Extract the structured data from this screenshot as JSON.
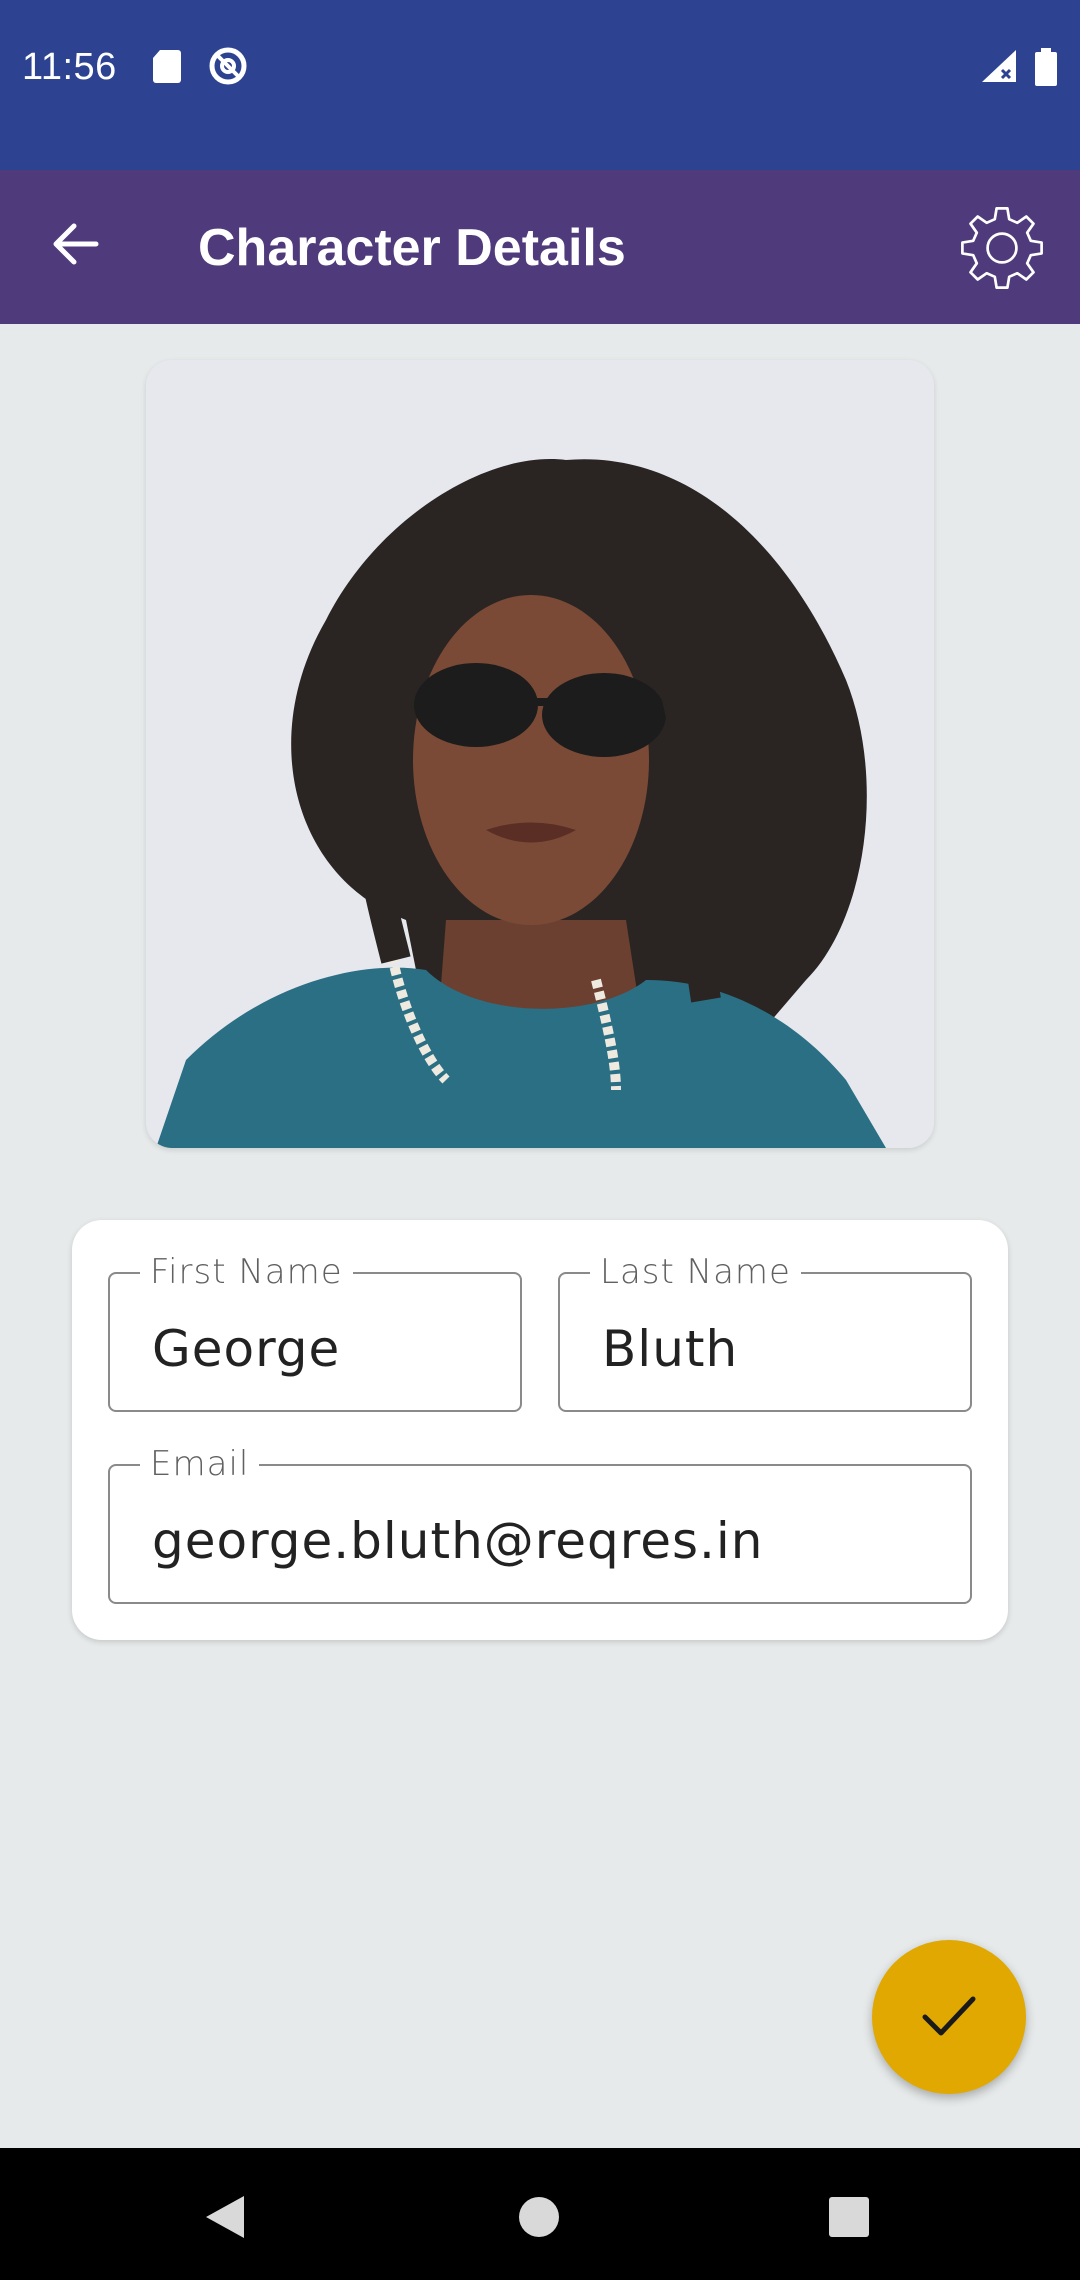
{
  "status_bar": {
    "time": "11:56",
    "icons": [
      "sd-card-icon",
      "at-sign-icon",
      "signal-icon",
      "battery-icon"
    ],
    "background": "#2d4391"
  },
  "app_bar": {
    "title": "Character Details",
    "back_icon": "arrow-back-icon",
    "settings_icon": "gear-icon",
    "background": "#4f3a7c"
  },
  "photo": {
    "description_icon": "profile-photo"
  },
  "form": {
    "first_name": {
      "label": "First Name",
      "value": "George"
    },
    "last_name": {
      "label": "Last Name",
      "value": "Bluth"
    },
    "email": {
      "label": "Email",
      "value": "george.bluth@reqres.in"
    }
  },
  "fab": {
    "icon": "check-icon",
    "color": "#e0a800"
  },
  "nav_bar": {
    "buttons": [
      "back-triangle-icon",
      "home-circle-icon",
      "recents-square-icon"
    ]
  }
}
